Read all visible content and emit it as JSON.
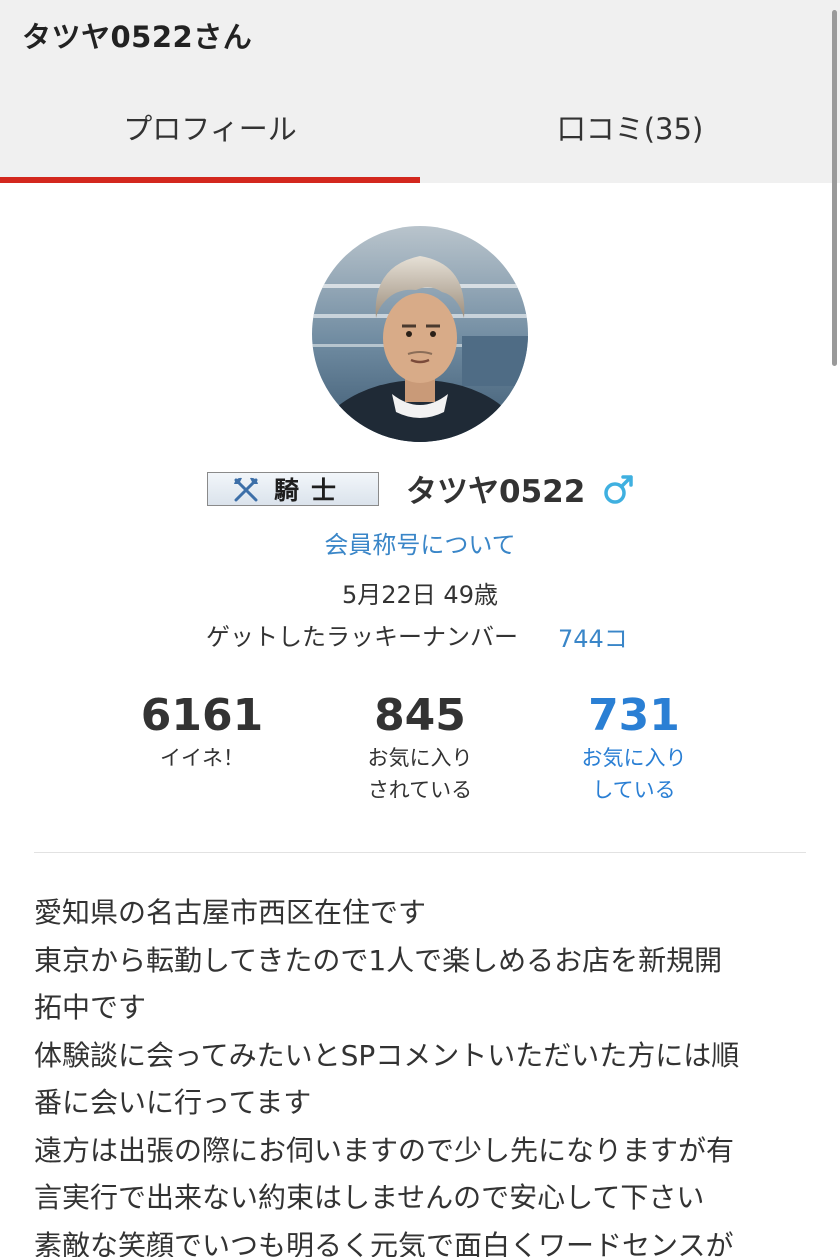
{
  "header": {
    "title": "タツヤ0522さん"
  },
  "tabs": [
    {
      "label": "プロフィール",
      "active": true
    },
    {
      "label": "口コミ(35)",
      "active": false
    }
  ],
  "colors": {
    "accent": "#d3281e",
    "link": "#3a86c8",
    "highlight_stat": "#2a7fd4",
    "gender_icon": "#3fb0e0"
  },
  "profile": {
    "avatar_icon": "user-photo",
    "rank_label": "騎士",
    "rank_icon": "crossed-axes-icon",
    "username": "タツヤ0522",
    "gender_icon": "male-symbol-icon",
    "title_link": "会員称号について",
    "birthday": "5月22日 49歳",
    "lucky_label": "ゲットしたラッキーナンバー",
    "lucky_value": "744コ"
  },
  "stats": [
    {
      "value": "6161",
      "label": "イイネ！"
    },
    {
      "value": "845",
      "label": "お気に入り\nされている"
    },
    {
      "value": "731",
      "label": "お気に入り\nしている"
    }
  ],
  "bio_lines": [
    "愛知県の名古屋市西区在住です",
    "東京から転勤してきたので1人で楽しめるお店を新規開",
    "拓中です",
    "体験談に会ってみたいとSPコメントいただいた方には順",
    "番に会いに行ってます",
    "遠方は出張の際にお伺いますので少し先になりますが有",
    "言実行で出来ない約束はしませんので安心して下さい",
    "素敵な笑顔でいつも明るく元気で面白くワードセンスが"
  ]
}
